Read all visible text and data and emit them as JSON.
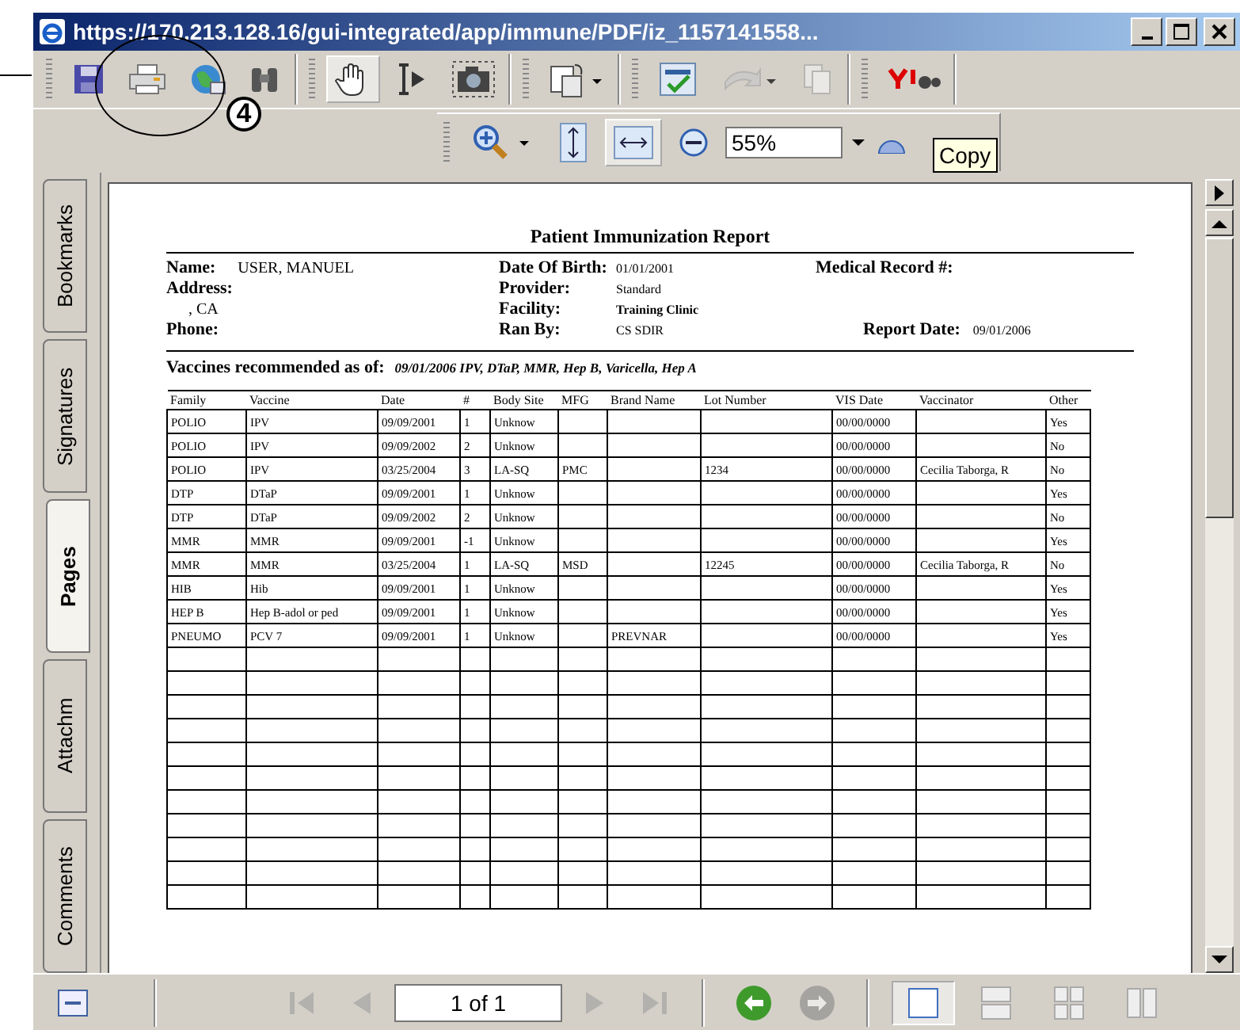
{
  "window": {
    "title": "https://170.213.128.16/gui-integrated/app/immune/PDF/iz_1157141558..."
  },
  "toolbar": {
    "hand_tool": {
      "selected": true
    },
    "select_tool": {
      "selected": false
    },
    "snapshot_tool": {
      "selected": false
    }
  },
  "zoom_toolbar": {
    "fit_page": {
      "selected": false
    },
    "fit_width": {
      "selected": true
    },
    "zoom": "55%"
  },
  "tooltip": "Copy",
  "callout": "4",
  "sidebar_tabs": [
    {
      "label": "Bookmarks",
      "selected": false
    },
    {
      "label": "Signatures",
      "selected": false
    },
    {
      "label": "Pages",
      "selected": true
    },
    {
      "label": "Attachm",
      "selected": false
    },
    {
      "label": "Comments",
      "selected": false
    }
  ],
  "report": {
    "title": "Patient Immunization Report",
    "fields": [
      {
        "label": "Name:",
        "value": "USER, MANUEL"
      },
      {
        "label": "Address:",
        "value": ", CA"
      },
      {
        "label": "Phone:"
      }
    ],
    "fields_mid": [
      {
        "label": "Date Of Birth:",
        "value": "01/01/2001"
      },
      {
        "label": "Provider:",
        "value": "Standard"
      },
      {
        "label": "Facility:",
        "value": "Training Clinic"
      },
      {
        "label": "Ran By:",
        "value": "CS SDIR"
      }
    ],
    "medical_record": "Medical Record #:",
    "report_date_label": "Report Date:",
    "report_date": "09/01/2006",
    "recommended_label": "Vaccines recommended as of:",
    "recommended": "09/01/2006 IPV, DTaP, MMR, Hep B, Varicella, Hep A",
    "table": {
      "columns": [
        "Family",
        "Vaccine",
        "Date",
        "#",
        "Body Site",
        "MFG",
        "Brand Name",
        "Lot Number",
        "VIS Date",
        "Vaccinator",
        "Other"
      ],
      "rows": [
        [
          "POLIO",
          "IPV",
          "09/09/2001",
          "1",
          "Unknow",
          "",
          "",
          "",
          "00/00/0000",
          "",
          "Yes"
        ],
        [
          "POLIO",
          "IPV",
          "09/09/2002",
          "2",
          "Unknow",
          "",
          "",
          "",
          "00/00/0000",
          "",
          "No"
        ],
        [
          "POLIO",
          "IPV",
          "03/25/2004",
          "3",
          "LA-SQ",
          "PMC",
          "",
          "1234",
          "00/00/0000",
          "Cecilia Taborga, R",
          "No"
        ],
        [
          "DTP",
          "DTaP",
          "09/09/2001",
          "1",
          "Unknow",
          "",
          "",
          "",
          "00/00/0000",
          "",
          "Yes"
        ],
        [
          "DTP",
          "DTaP",
          "09/09/2002",
          "2",
          "Unknow",
          "",
          "",
          "",
          "00/00/0000",
          "",
          "No"
        ],
        [
          "MMR",
          "MMR",
          "09/09/2001",
          "-1",
          "Unknow",
          "",
          "",
          "",
          "00/00/0000",
          "",
          "Yes"
        ],
        [
          "MMR",
          "MMR",
          "03/25/2004",
          "1",
          "LA-SQ",
          "MSD",
          "",
          "12245",
          "00/00/0000",
          "Cecilia Taborga, R",
          "No"
        ],
        [
          "HIB",
          "Hib",
          "09/09/2001",
          "1",
          "Unknow",
          "",
          "",
          "",
          "00/00/0000",
          "",
          "Yes"
        ],
        [
          "HEP B",
          "Hep B-adol or ped",
          "09/09/2001",
          "1",
          "Unknow",
          "",
          "",
          "",
          "00/00/0000",
          "",
          "Yes"
        ],
        [
          "PNEUMO",
          "PCV 7",
          "09/09/2001",
          "1",
          "Unknow",
          "",
          "PREVNAR",
          "",
          "00/00/0000",
          "",
          "Yes"
        ]
      ]
    }
  },
  "navigation": {
    "page": "1 of 1",
    "first": {
      "disabled": true
    },
    "previous": {
      "disabled": true
    },
    "next": {
      "disabled": true
    },
    "last": {
      "disabled": true
    },
    "back": {
      "disabled": false
    },
    "forward": {
      "disabled": true
    }
  },
  "view_modes": [
    {
      "selected": true
    },
    {
      "selected": false
    },
    {
      "selected": false
    },
    {
      "selected": false
    }
  ]
}
